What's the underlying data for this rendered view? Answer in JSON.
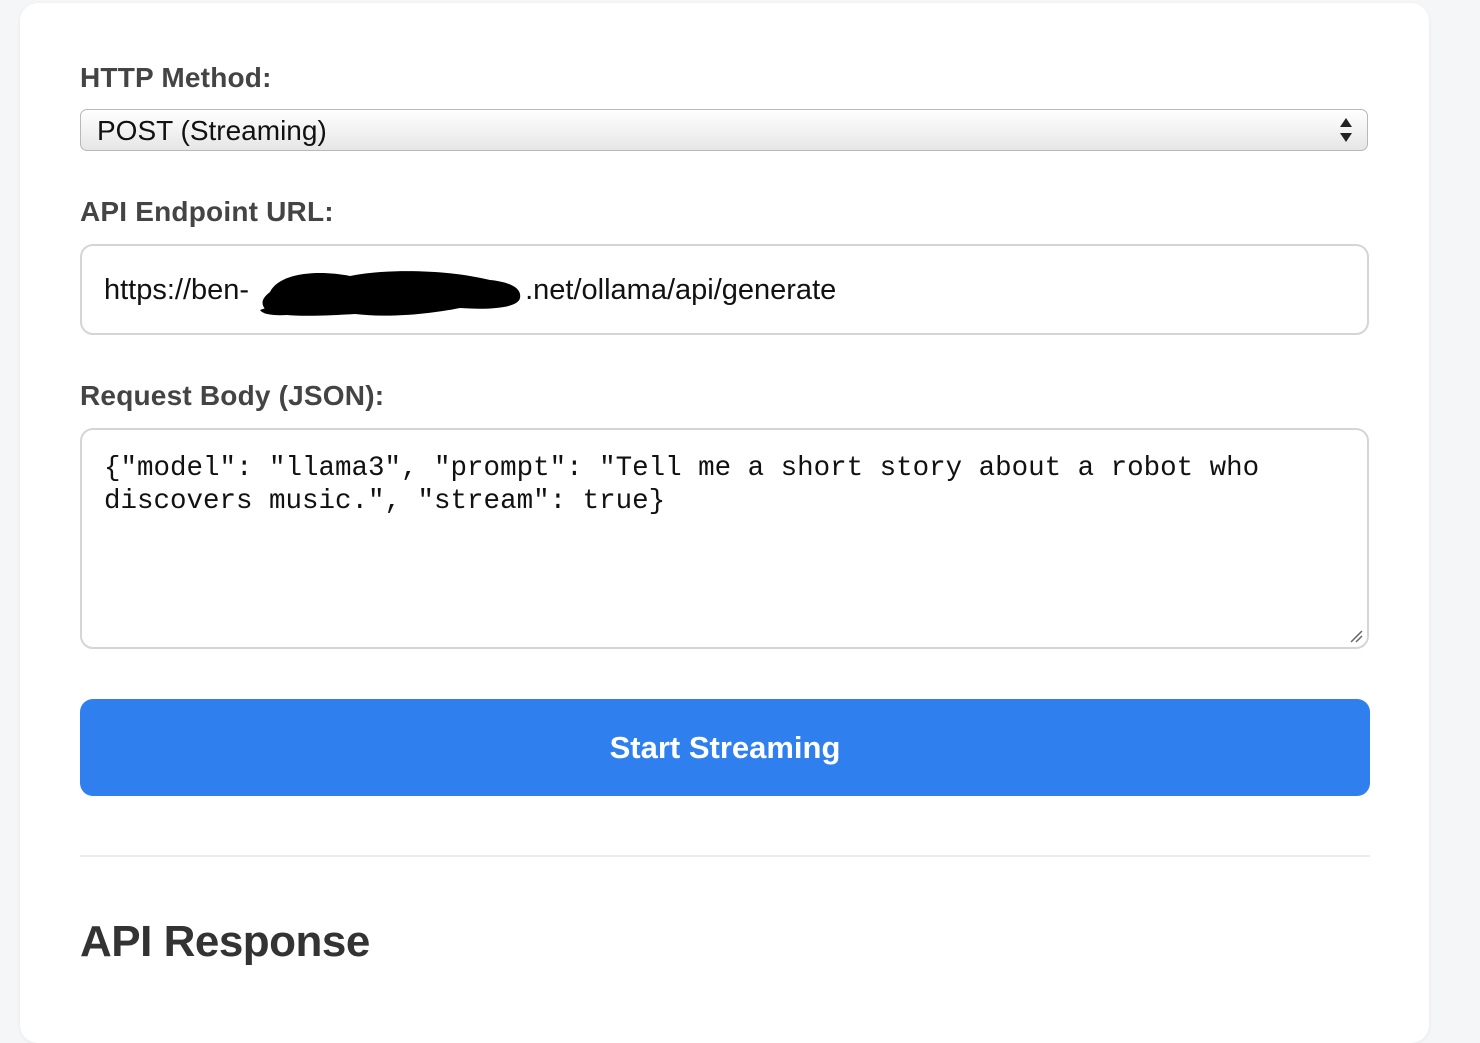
{
  "form": {
    "method_label": "HTTP Method:",
    "method_value": "POST (Streaming)",
    "url_label": "API Endpoint URL:",
    "url_prefix": "https://ben-",
    "url_suffix": ".net/ollama/api/generate",
    "body_label": "Request Body (JSON):",
    "body_value": "{\"model\": \"llama3\", \"prompt\": \"Tell me a short story about a robot who discovers music.\", \"stream\": true}",
    "submit_label": "Start Streaming"
  },
  "response": {
    "title": "API Response"
  },
  "colors": {
    "accent": "#2f80ee",
    "label": "#444444",
    "border": "#d5d5d5"
  },
  "icons": {
    "select": "chevron-up-down-icon",
    "resize": "resize-handle-icon"
  }
}
